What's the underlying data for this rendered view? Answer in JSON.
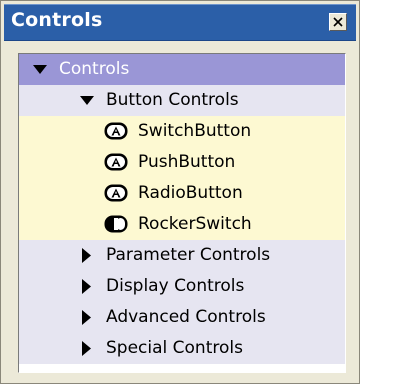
{
  "panel": {
    "title": "Controls"
  },
  "tree": {
    "root": {
      "label": "Controls",
      "expanded": true
    },
    "groups": [
      {
        "label": "Button Controls",
        "expanded": true,
        "items": [
          {
            "label": "SwitchButton",
            "icon": "button-a-icon"
          },
          {
            "label": "PushButton",
            "icon": "button-a-icon"
          },
          {
            "label": "RadioButton",
            "icon": "button-a-icon"
          },
          {
            "label": "RockerSwitch",
            "icon": "rocker-switch-icon"
          }
        ]
      },
      {
        "label": "Parameter Controls",
        "expanded": false
      },
      {
        "label": "Display Controls",
        "expanded": false
      },
      {
        "label": "Advanced Controls",
        "expanded": false
      },
      {
        "label": "Special Controls",
        "expanded": false
      }
    ]
  },
  "colors": {
    "titlebar": "#2b5fa8",
    "root_row": "#9a96d6",
    "group_row": "#e6e5f1",
    "item_row": "#fdf9d2",
    "panel_bg": "#ece9d8"
  }
}
